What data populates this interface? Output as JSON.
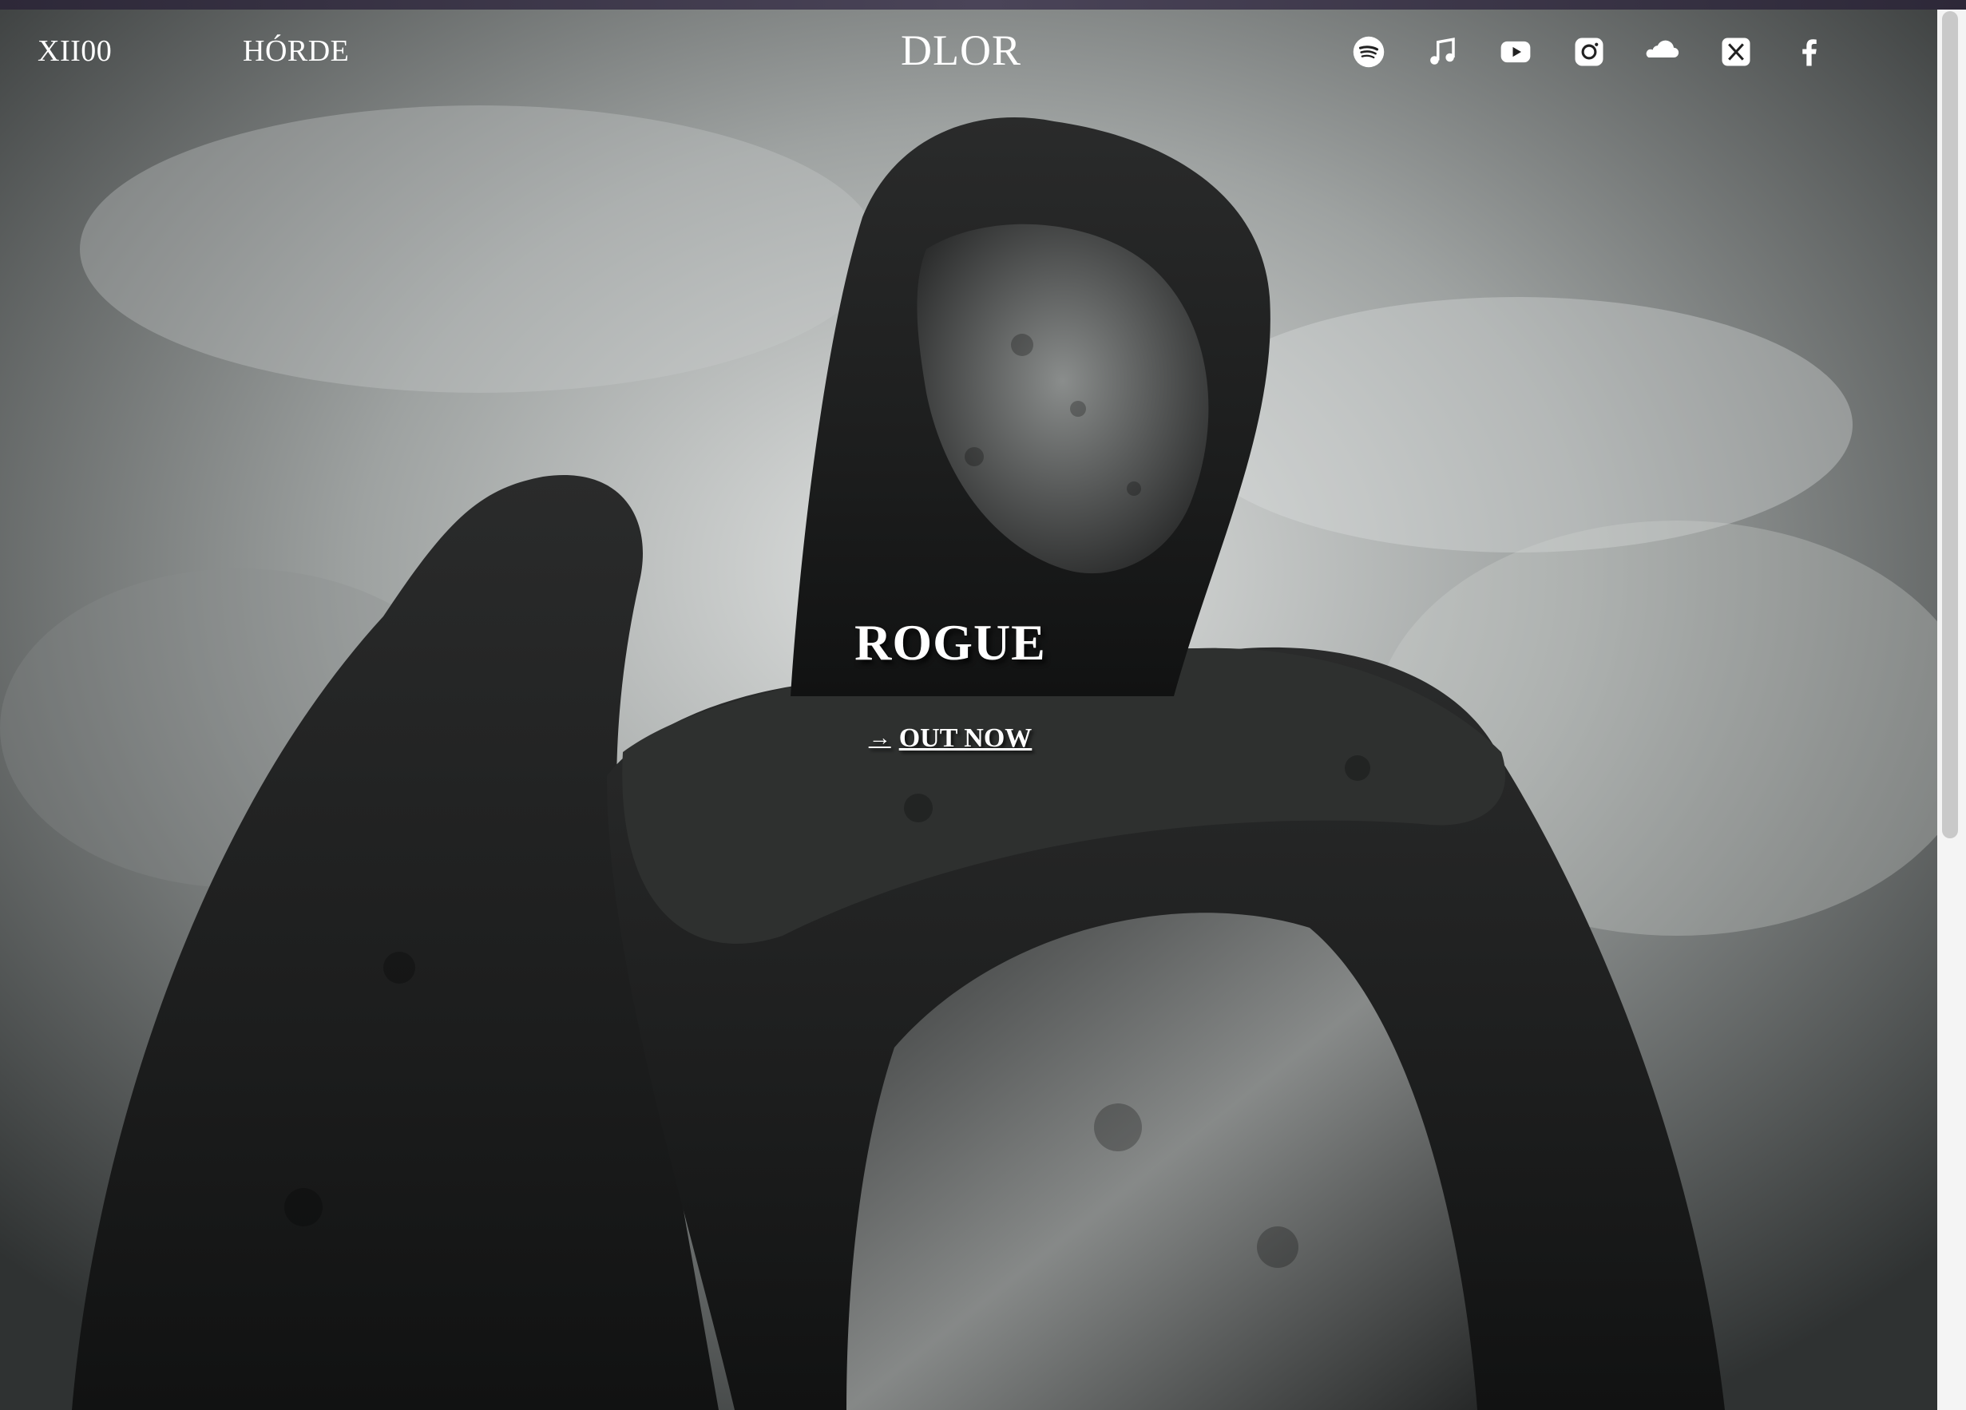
{
  "nav": {
    "link_1": "XII00",
    "link_2": "HÓRDE",
    "logo": "DLOR"
  },
  "social_icons": [
    "spotify-icon",
    "apple-music-icon",
    "youtube-icon",
    "instagram-icon",
    "soundcloud-icon",
    "x-icon",
    "facebook-icon"
  ],
  "hero": {
    "title": "ROGUE",
    "cta_label": "OUT NOW",
    "cta_arrow": "→",
    "background": "black-and-white photo of a weathered stone angel statue against a cloudy sky"
  },
  "colors": {
    "text": "#ffffff",
    "chrome": "#3a3548"
  }
}
